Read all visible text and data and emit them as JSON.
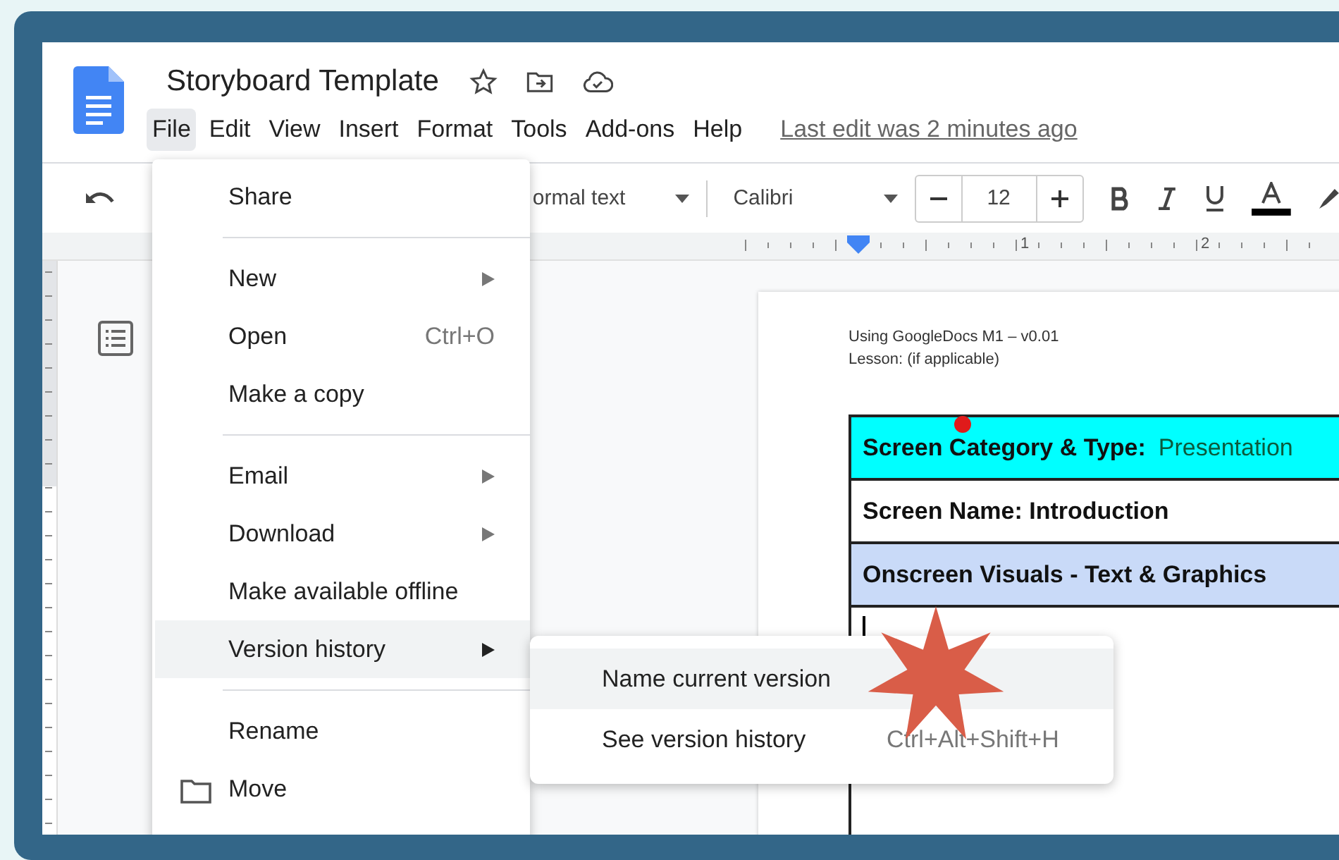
{
  "document_title": "Storyboard Template",
  "menu_bar": [
    {
      "label": "File",
      "selected": true
    },
    {
      "label": "Edit",
      "selected": false
    },
    {
      "label": "View",
      "selected": false
    },
    {
      "label": "Insert",
      "selected": false
    },
    {
      "label": "Format",
      "selected": false
    },
    {
      "label": "Tools",
      "selected": false
    },
    {
      "label": "Add-ons",
      "selected": false
    },
    {
      "label": "Help",
      "selected": false
    }
  ],
  "last_edit": "Last edit was 2 minutes ago",
  "toolbar": {
    "paragraph_style": "ormal text",
    "font": "Calibri",
    "font_size": "12"
  },
  "ruler": {
    "labels": [
      "1",
      "2"
    ]
  },
  "page": {
    "header_lines": [
      "Using GoogleDocs M1 – v0.01",
      "Lesson: (if applicable)"
    ],
    "table_rows": [
      {
        "kind": "heading",
        "label": "Screen Category & Type:",
        "value": "Presentation",
        "color": "#00ffff"
      },
      {
        "kind": "heading",
        "label": "Screen Name: Introduction",
        "color": "#ffffff"
      },
      {
        "kind": "heading",
        "label": "Onscreen Visuals - Text & Graphics",
        "color": "#c9daf8"
      },
      {
        "kind": "cursor",
        "color": "#ffffff"
      }
    ]
  },
  "file_menu": [
    [
      {
        "label": "Share",
        "has_submenu": false,
        "selected": false
      }
    ],
    [
      {
        "label": "New",
        "has_submenu": true,
        "selected": false
      },
      {
        "label": "Open",
        "shortcut": "Ctrl+O",
        "has_submenu": false,
        "selected": false
      },
      {
        "label": "Make a copy",
        "has_submenu": false,
        "selected": false
      }
    ],
    [
      {
        "label": "Email",
        "has_submenu": true,
        "selected": false
      },
      {
        "label": "Download",
        "has_submenu": true,
        "selected": false
      },
      {
        "label": "Make available offline",
        "has_submenu": false,
        "selected": false
      },
      {
        "label": "Version history",
        "has_submenu": true,
        "selected": true
      }
    ],
    [
      {
        "label": "Rename",
        "has_submenu": false,
        "selected": false
      },
      {
        "label": "Move",
        "has_submenu": false,
        "selected": false,
        "has_icon": true
      }
    ]
  ],
  "version_submenu": [
    {
      "label": "Name current version",
      "selected": true
    },
    {
      "label": "See version history",
      "shortcut": "Ctrl+Alt+Shift+H",
      "selected": false
    }
  ]
}
